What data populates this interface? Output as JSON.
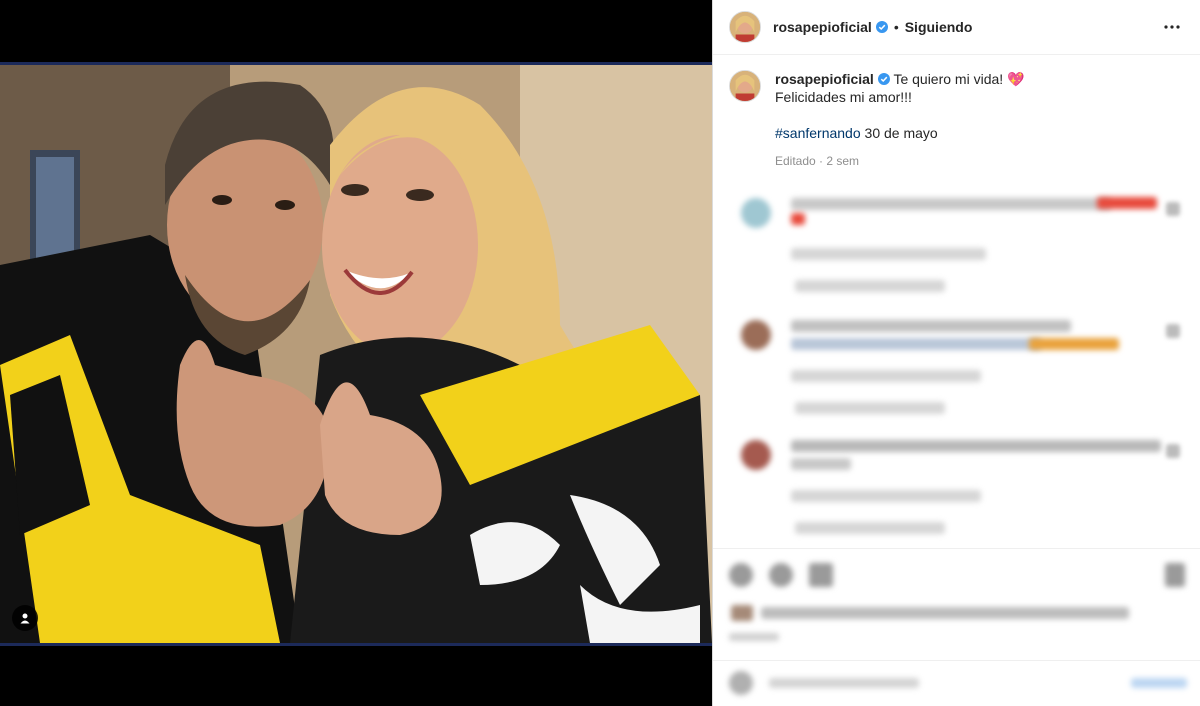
{
  "post": {
    "username": "rosapepioficial",
    "follow_status": "Siguiendo",
    "separator": "•",
    "caption_line1": "Te quiero mi vida! 💖",
    "caption_line2": "Felicidades mi amor!!!",
    "hashtag": "#sanfernando",
    "caption_tail": " 30 de mayo",
    "meta": "Editado · 2 sem"
  },
  "icons": {
    "verified": "verified-badge-icon",
    "more": "more-options-icon",
    "tag": "user-tag-icon"
  },
  "colors": {
    "verified_blue": "#3897f0",
    "hashtag": "#00376b",
    "text": "#262626",
    "muted": "#8e8e8e"
  }
}
